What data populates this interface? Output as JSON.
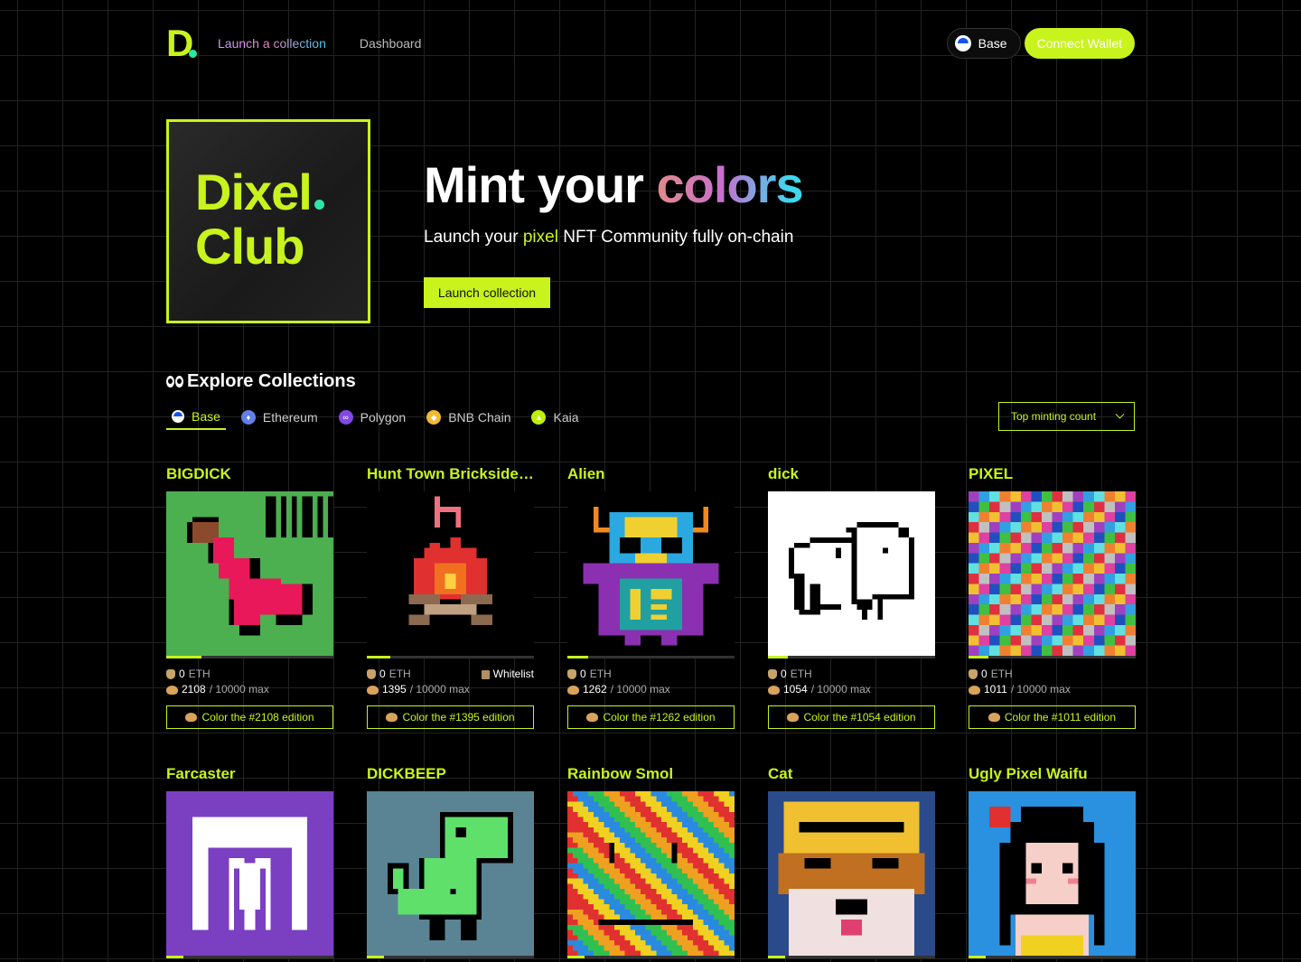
{
  "nav": {
    "logo_letter": "D",
    "launch_link": "Launch a collection",
    "dashboard_link": "Dashboard",
    "chain_selector": "Base",
    "connect_wallet": "Connect Wallet"
  },
  "hero": {
    "card_line1": "Dixel",
    "card_line2": "Club",
    "title_plain": "Mint your ",
    "title_accent": "colors",
    "subtitle_before": "Launch your ",
    "subtitle_highlight": "pixel",
    "subtitle_after": " NFT Community fully on-chain",
    "cta": "Launch collection"
  },
  "explore": {
    "heading": "Explore Collections",
    "tabs": [
      {
        "label": "Base",
        "icon": "base-icon",
        "color": "#1652f0"
      },
      {
        "label": "Ethereum",
        "icon": "ethereum-icon",
        "color": "#627eea"
      },
      {
        "label": "Polygon",
        "icon": "polygon-icon",
        "color": "#8247e5"
      },
      {
        "label": "BNB Chain",
        "icon": "bnb-icon",
        "color": "#f3ba2f"
      },
      {
        "label": "Kaia",
        "icon": "kaia-icon",
        "color": "#bff009"
      }
    ],
    "sort": "Top minting count"
  },
  "collections": [
    {
      "title": "BIGDICK",
      "price": "0",
      "unit": "ETH",
      "minted": "2108",
      "max": " / 10000 max",
      "button": "Color the #2108 edition",
      "progress": 0.2108
    },
    {
      "title": "Hunt Town Brickside ...",
      "price": "0",
      "unit": "ETH",
      "minted": "1395",
      "max": " / 10000 max",
      "button": "Color the #1395 edition",
      "whitelist": "Whitelist",
      "progress": 0.1395
    },
    {
      "title": "Alien",
      "price": "0",
      "unit": "ETH",
      "minted": "1262",
      "max": " / 10000 max",
      "button": "Color the #1262 edition",
      "progress": 0.1262
    },
    {
      "title": "dick",
      "price": "0",
      "unit": "ETH",
      "minted": "1054",
      "max": " / 10000 max",
      "button": "Color the #1054 edition",
      "progress": 0.1054
    },
    {
      "title": "PIXEL",
      "price": "0",
      "unit": "ETH",
      "minted": "1011",
      "max": " / 10000 max",
      "button": "Color the #1011 edition",
      "progress": 0.1011
    },
    {
      "title": "Farcaster"
    },
    {
      "title": "DICKBEEP"
    },
    {
      "title": "Rainbow Smol"
    },
    {
      "title": "Cat"
    },
    {
      "title": "Ugly Pixel Waifu"
    }
  ],
  "colors": {
    "accent": "#c8f31d",
    "mint": "#2ee6a6",
    "background": "#000000"
  }
}
